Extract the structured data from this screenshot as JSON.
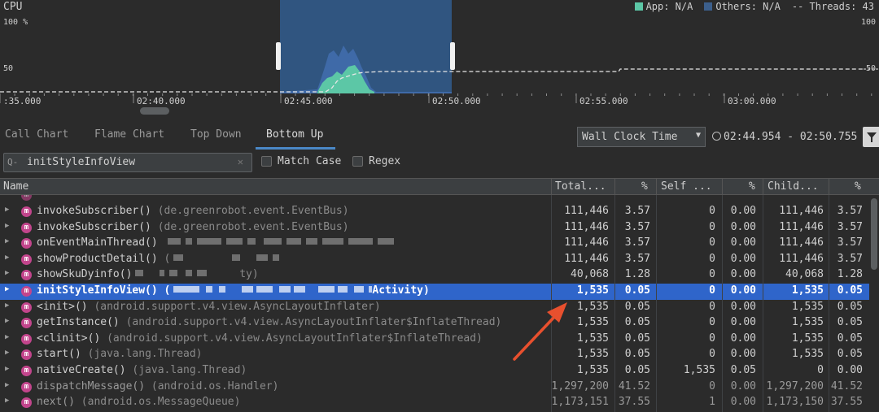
{
  "cpu": {
    "title": "CPU",
    "y_top_left": "100 %",
    "y_mid_left": "50",
    "y_top_right": "100",
    "y_mid_right": "50",
    "legend": {
      "app": "App: N/A",
      "others": "Others: N/A",
      "threads": "-- Threads: 43",
      "app_color": "#5cc7a6",
      "others_color": "#3c5f8c"
    },
    "time_labels": [
      ":35.000",
      "02:40.000",
      "02:45.000",
      "02:50.000",
      "02:55.000",
      "03:00.000"
    ]
  },
  "tabs": [
    "Call Chart",
    "Flame Chart",
    "Top Down",
    "Bottom Up"
  ],
  "active_tab": "Bottom Up",
  "clock": {
    "selected": "Wall Clock Time",
    "range": "02:44.954 - 02:50.755"
  },
  "search": {
    "value": "initStyleInfoView",
    "match_case": "Match Case",
    "regex": "Regex"
  },
  "columns": [
    "Name",
    "Total...",
    "%",
    "Self ...",
    "%",
    "Child...",
    "%"
  ],
  "rows": [
    {
      "fn": "invokeSubscriber()",
      "pkg": "(de.greenrobot.event.EventBus)",
      "total": "111,446",
      "tp": "3.57",
      "self": "0",
      "sp": "0.00",
      "child": "111,446",
      "cp": "3.57"
    },
    {
      "fn": "invokeSubscriber()",
      "pkg": "(de.greenrobot.event.EventBus)",
      "total": "111,446",
      "tp": "3.57",
      "self": "0",
      "sp": "0.00",
      "child": "111,446",
      "cp": "3.57"
    },
    {
      "fn": "onEventMainThread()",
      "pkg": "",
      "total": "111,446",
      "tp": "3.57",
      "self": "0",
      "sp": "0.00",
      "child": "111,446",
      "cp": "3.57"
    },
    {
      "fn": "showProductDetail()",
      "pkg": "(",
      "total": "111,446",
      "tp": "3.57",
      "self": "0",
      "sp": "0.00",
      "child": "111,446",
      "cp": "3.57"
    },
    {
      "fn": "showSkuDyinfo()",
      "pkg": "ty)",
      "total": "40,068",
      "tp": "1.28",
      "self": "0",
      "sp": "0.00",
      "child": "40,068",
      "cp": "1.28"
    },
    {
      "fn": "initStyleInfoView()",
      "pkg": "(",
      "pkg_tail": "Activity)",
      "total": "1,535",
      "tp": "0.05",
      "self": "0",
      "sp": "0.00",
      "child": "1,535",
      "cp": "0.05"
    },
    {
      "fn": "<init>()",
      "pkg": "(android.support.v4.view.AsyncLayoutInflater)",
      "total": "1,535",
      "tp": "0.05",
      "self": "0",
      "sp": "0.00",
      "child": "1,535",
      "cp": "0.05"
    },
    {
      "fn": "getInstance()",
      "pkg": "(android.support.v4.view.AsyncLayoutInflater$InflateThread)",
      "total": "1,535",
      "tp": "0.05",
      "self": "0",
      "sp": "0.00",
      "child": "1,535",
      "cp": "0.05"
    },
    {
      "fn": "<clinit>()",
      "pkg": "(android.support.v4.view.AsyncLayoutInflater$InflateThread)",
      "total": "1,535",
      "tp": "0.05",
      "self": "0",
      "sp": "0.00",
      "child": "1,535",
      "cp": "0.05"
    },
    {
      "fn": "start()",
      "pkg": "(java.lang.Thread)",
      "total": "1,535",
      "tp": "0.05",
      "self": "0",
      "sp": "0.00",
      "child": "1,535",
      "cp": "0.05"
    },
    {
      "fn": "nativeCreate()",
      "pkg": "(java.lang.Thread)",
      "total": "1,535",
      "tp": "0.05",
      "self": "1,535",
      "sp": "0.05",
      "child": "0",
      "cp": "0.00"
    },
    {
      "fn": "dispatchMessage()",
      "pkg": "(android.os.Handler)",
      "total": "1,297,200",
      "tp": "41.52",
      "self": "0",
      "sp": "0.00",
      "child": "1,297,200",
      "cp": "41.52"
    },
    {
      "fn": "next()",
      "pkg": "(android.os.MessageQueue)",
      "total": "1,173,151",
      "tp": "37.55",
      "self": "1",
      "sp": "0.00",
      "child": "1,173,150",
      "cp": "37.55"
    }
  ],
  "colors": {
    "selection": "#2f65ca",
    "method_icon": "#c2458c",
    "annotation_arrow": "#e8502e"
  }
}
